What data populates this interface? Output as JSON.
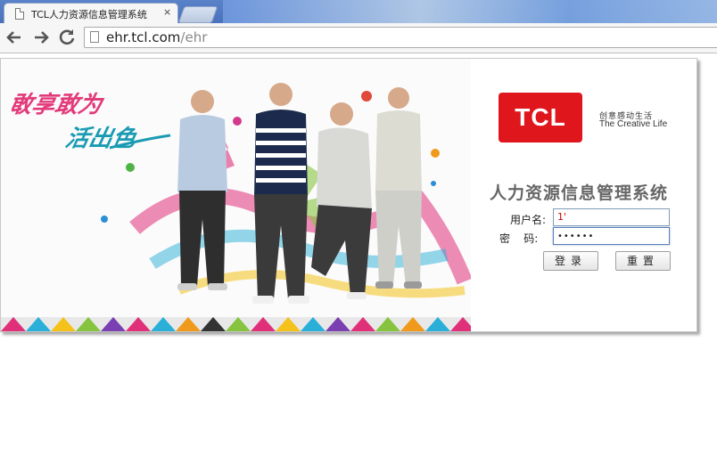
{
  "browser": {
    "tab_title": "TCL人力资源信息管理系统",
    "tab_close": "×",
    "url_host": "ehr.tcl.com",
    "url_path": "/ehr",
    "back_icon": "arrow-left-icon",
    "forward_icon": "arrow-right-icon",
    "reload_icon": "reload-icon"
  },
  "banner": {
    "slogan": "敢享敢为 活出色"
  },
  "brand": {
    "logo": "TCL",
    "tagline_cn": "创意感动生活",
    "tagline_en": "The Creative Life",
    "color": "#e0161d"
  },
  "login": {
    "title": "人力资源信息管理系统",
    "username_label": "用户名:",
    "username_value": "1'",
    "password_label": "密    码:",
    "password_value": "••••••",
    "login_button": "登录",
    "reset_button": "重置"
  }
}
